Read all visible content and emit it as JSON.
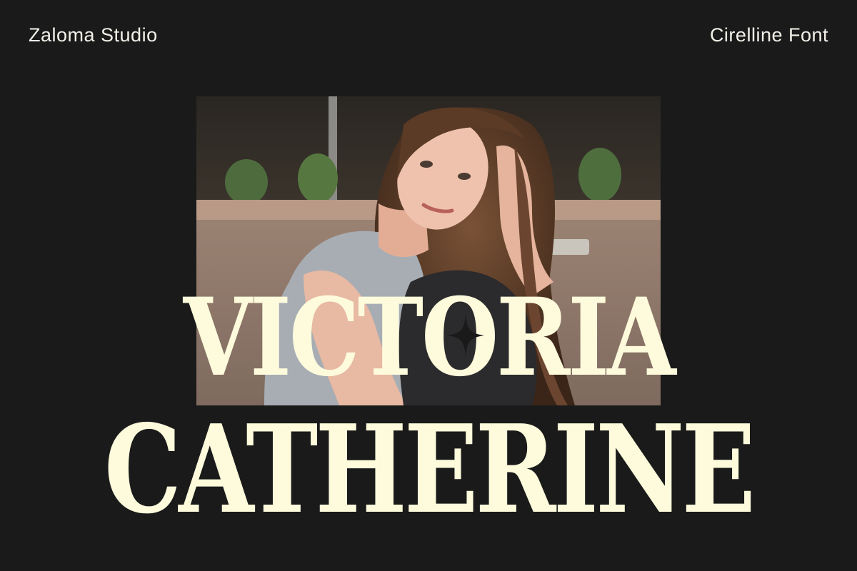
{
  "header": {
    "studio": "Zaloma Studio",
    "font_name": "Cirelline Font"
  },
  "display": {
    "line1": "VICTORIA",
    "line2": "CATHERINE"
  },
  "colors": {
    "background": "#1a1a1a",
    "display_text": "#fdfbdc",
    "header_text": "#f2f0e8"
  },
  "icons": {
    "sparkle": "four-point-star-icon"
  }
}
